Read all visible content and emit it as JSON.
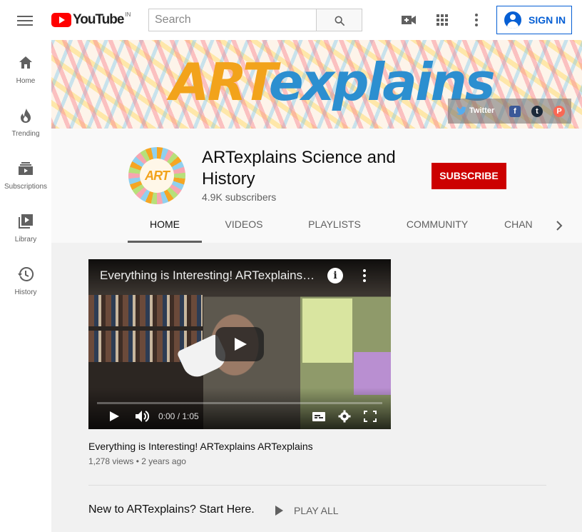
{
  "brand": {
    "name": "YouTube",
    "region": "IN"
  },
  "search": {
    "placeholder": "Search"
  },
  "header": {
    "sign_in_label": "SIGN IN"
  },
  "sidebar": {
    "items": [
      {
        "label": "Home",
        "icon": "home-icon"
      },
      {
        "label": "Trending",
        "icon": "trending-icon"
      },
      {
        "label": "Subscriptions",
        "icon": "subscriptions-icon"
      },
      {
        "label": "Library",
        "icon": "library-icon"
      },
      {
        "label": "History",
        "icon": "history-icon"
      }
    ]
  },
  "banner": {
    "art_text": "ART",
    "explains_text": "explains",
    "social": {
      "twitter_label": "Twitter"
    }
  },
  "channel": {
    "avatar_text": "ART",
    "title": "ARTexplains Science and History",
    "subscribers": "4.9K subscribers",
    "subscribe_label": "SUBSCRIBE",
    "tabs": [
      {
        "label": "HOME",
        "active": true
      },
      {
        "label": "VIDEOS",
        "active": false
      },
      {
        "label": "PLAYLISTS",
        "active": false
      },
      {
        "label": "COMMUNITY",
        "active": false
      },
      {
        "label": "CHAN",
        "active": false
      }
    ]
  },
  "featured_video": {
    "player_title": "Everything is Interesting! ARTexplains…",
    "time_display": "0:00 / 1:05",
    "title": "Everything is Interesting! ARTexplains ARTexplains",
    "meta": "1,278 views • 2 years ago"
  },
  "section": {
    "title": "New to ARTexplains? Start Here.",
    "play_all_label": "PLAY ALL"
  },
  "colors": {
    "brand_red": "#ff0000",
    "subscribe_red": "#cc0000",
    "link_blue": "#065fd4"
  }
}
